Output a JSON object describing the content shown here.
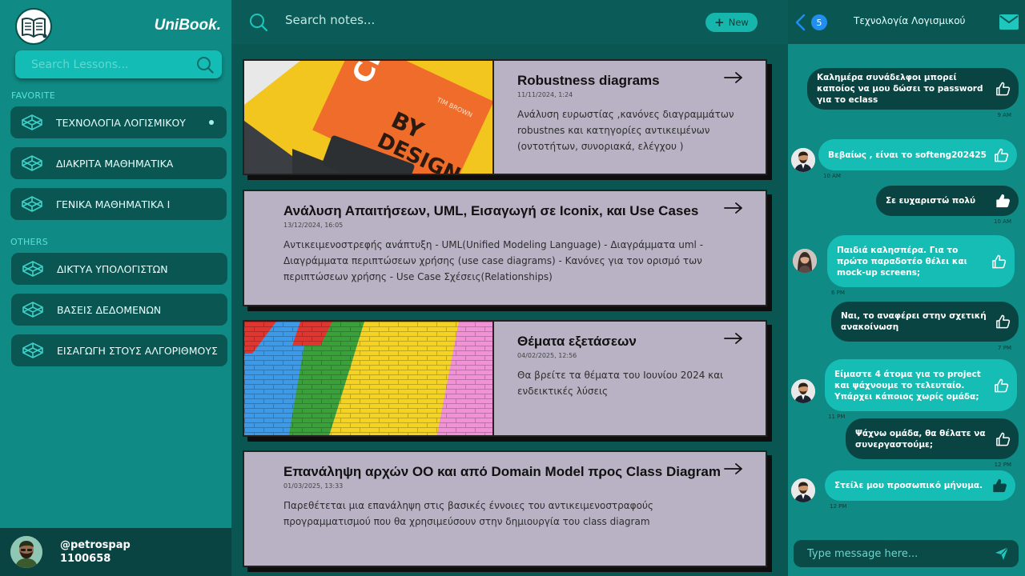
{
  "app": {
    "brand": "UniBook."
  },
  "sidebar": {
    "search_placeholder": "Search Lessons...",
    "favorite_label": "FAVORITE",
    "favorites": [
      {
        "label": "ΤΕΧΝΟΛΟΓΙΑ ΛΟΓΙΣΜΙΚΟΥ",
        "active": true
      },
      {
        "label": "ΔΙΑΚΡΙΤΑ ΜΑΘΗΜΑΤΙΚΑ"
      },
      {
        "label": "ΓΕΝΙΚΑ ΜΑΘΗΜΑΤΙΚΑ Ι"
      }
    ],
    "others_label": "OTHERS",
    "others": [
      {
        "label": "ΔΙΚΤΥΑ ΥΠΟΛΟΓΙΣΤΩΝ"
      },
      {
        "label": "ΒΑΣΕΙΣ ΔΕΔΟΜΕΝΩΝ"
      },
      {
        "label": "ΕΙΣΑΓΩΓΗ ΣΤΟΥΣ ΑΛΓΟΡΙΘΜΟΥΣ"
      }
    ],
    "user": {
      "handle": "@petrospap",
      "id": "1100658"
    }
  },
  "notes": {
    "search_placeholder": "Search notes...",
    "new_label": "New",
    "cards": [
      {
        "title": "Robustness diagrams",
        "date": "11/11/2024, 1:24",
        "description": "Ανάλυση ευρωστίας ,κανόνες διαγραμμάτων robustnes και κατηγορίες αντικειμένων (οντοτήτων, συνοριακά, ελέγχου )",
        "image_text": [
          "CHAN",
          "BY",
          "DESIGN",
          "TIM BROWN"
        ]
      },
      {
        "title": "Ανάλυση Απαιτήσεων, UML, Εισαγωγή σε Iconix, και Use Cases",
        "date": "13/12/2024, 16:05",
        "description": "Αντικειμενοστρεφής ανάπτυξη - UML(Unified Modeling Language) - Διαγράμματα uml - Διαγράμματα περιπτώσεων χρήσης (use case diagrams) - Κανόνες για τον ορισμό των περιπτώσεων χρήσης - Use Case Σχέσεις(Relationships)"
      },
      {
        "title": "Θέματα εξετάσεων",
        "date": "04/02/2025, 12:56",
        "description": "Θα βρείτε τα θέματα του Ιουνίου 2024 και ενδεικτικές λύσεις"
      },
      {
        "title": "Επανάληψη αρχών OO και από Domain Model προς Class Diagram",
        "date": "01/03/2025, 13:33",
        "description": "Παρεθέτεται μια επανάληψη στις βασικές  έννοιες του αντικειμενοστραφούς προγραμματισμού που θα χρησιμεύσουν στην δημιουργία του class diagram"
      }
    ]
  },
  "chat": {
    "badge": "5",
    "title": "Τεχνολογία Λογισμικού",
    "messages": [
      {
        "text": "Καλημέρα συνάδελφοι μπορεί καποίος να μου δώσει το password για το eclass",
        "time": "9 AM"
      },
      {
        "text": "Βεβαίως , είναι το softeng202425",
        "time": "10 AM"
      },
      {
        "text": "Σε ευχαριστώ πολύ",
        "time": "10 AM"
      },
      {
        "text": "Παιδιά καλησπέρα. Για το πρώτο παραδοτέο θέλει και mock-up screens;",
        "time": "6 PM"
      },
      {
        "text": "Ναι, το αναφέρει στην σχετική ανακοίνωση",
        "time": "7 PM"
      },
      {
        "text": "Είμαστε 4 άτομα για το project και ψάχνουμε το τελευταίο. Υπάρχει κάποιος χωρίς ομάδα;",
        "time": "11 PM"
      },
      {
        "text": "Ψάχνω ομάδα, θα θέλατε να συνεργαστούμε;",
        "time": "12 PM"
      },
      {
        "text": "Στείλε μου προσωπικό μήνυμα.",
        "time": "12 PM"
      }
    ],
    "compose_placeholder": "Type message here..."
  },
  "colors": {
    "sidebar": "#0f8a84",
    "main_bg": "#0a5652",
    "card": "#b8b2c4",
    "accent": "#16bdb4",
    "dark_bubble": "#0a4442"
  },
  "icons": [
    "book-logo-icon",
    "search-icon",
    "plus-icon",
    "codepen-cube-icon",
    "arrow-right-icon",
    "chevron-left-icon",
    "mail-icon",
    "thumbs-up-icon",
    "send-icon"
  ]
}
